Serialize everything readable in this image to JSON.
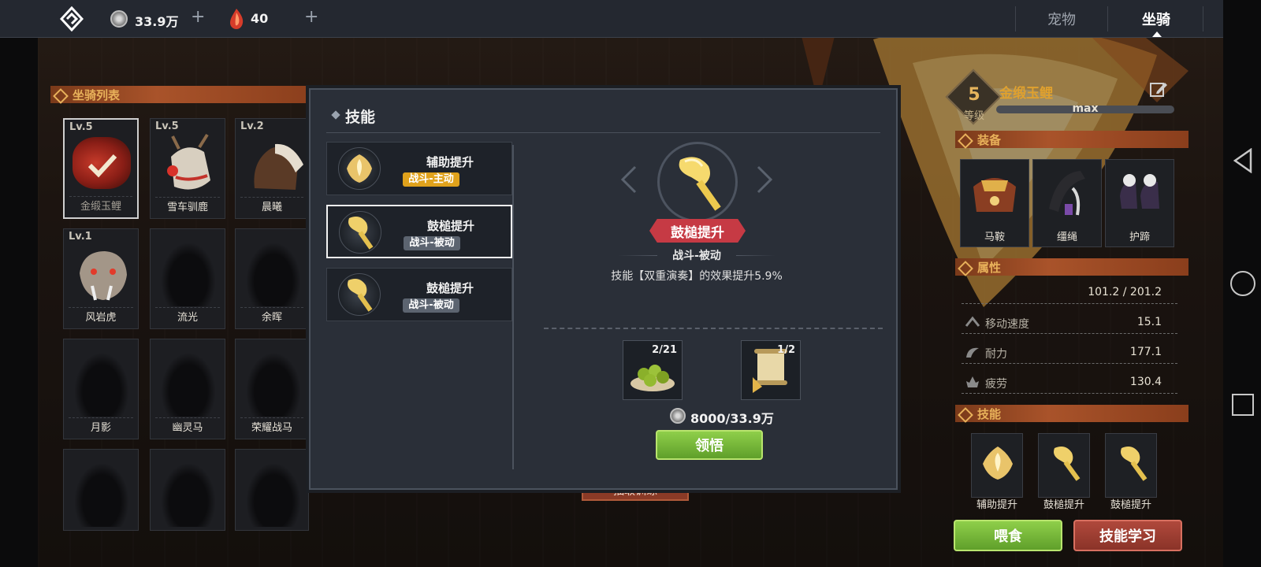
{
  "topbar": {
    "currency1": {
      "icon": "silver-coin-icon",
      "value": "33.9万"
    },
    "currency2": {
      "icon": "red-crystal-icon",
      "value": "40"
    },
    "tabs": [
      {
        "label": "宠物",
        "active": false
      },
      {
        "label": "坐骑",
        "active": true
      }
    ]
  },
  "mount_list": {
    "title": "坐骑列表",
    "items": [
      {
        "level": "Lv.5",
        "name": "金缎玉鲤",
        "owned": true,
        "selected": true
      },
      {
        "level": "Lv.5",
        "name": "雪车驯鹿",
        "owned": true
      },
      {
        "level": "Lv.2",
        "name": "晨曦",
        "owned": true
      },
      {
        "level": "Lv.1",
        "name": "风岩虎",
        "owned": true
      },
      {
        "level": "",
        "name": "流光",
        "owned": false
      },
      {
        "level": "",
        "name": "余晖",
        "owned": false
      },
      {
        "level": "",
        "name": "月影",
        "owned": false
      },
      {
        "level": "",
        "name": "幽灵马",
        "owned": false
      },
      {
        "level": "",
        "name": "荣耀战马",
        "owned": false
      },
      {
        "level": "",
        "name": "",
        "owned": false
      },
      {
        "level": "",
        "name": "",
        "owned": false
      },
      {
        "level": "",
        "name": "",
        "owned": false
      }
    ]
  },
  "mount_detail": {
    "level_number": "5",
    "level_label": "等级",
    "name": "金缎玉鲤",
    "progress_label": "max",
    "equipment_title": "装备",
    "equipment": [
      {
        "name": "马鞍"
      },
      {
        "name": "缰绳"
      },
      {
        "name": "护蹄"
      }
    ],
    "attributes_title": "属性",
    "attributes": [
      {
        "label": "",
        "value": "101.2 / 201.2"
      },
      {
        "label": "移动速度",
        "value": "15.1"
      },
      {
        "label": "耐力",
        "value": "177.1"
      },
      {
        "label": "疲劳",
        "value": "130.4"
      }
    ],
    "skills_title": "技能",
    "skills": [
      {
        "name": "辅助提升"
      },
      {
        "name": "鼓槌提升"
      },
      {
        "name": "鼓槌提升"
      }
    ],
    "feed_button": "喂食",
    "learn_button": "技能学习"
  },
  "modal": {
    "title": "技能",
    "skills": [
      {
        "name": "辅助提升",
        "tag": "战斗-主动",
        "tag_color": "#e0a21c",
        "selected": false,
        "icon": "flower-shield-icon"
      },
      {
        "name": "鼓槌提升",
        "tag": "战斗-被动",
        "tag_color": "#5c6470",
        "selected": true,
        "icon": "drumstick-icon"
      },
      {
        "name": "鼓槌提升",
        "tag": "战斗-被动",
        "tag_color": "#5c6470",
        "selected": false,
        "icon": "drumstick-icon"
      }
    ],
    "detail": {
      "name": "鼓槌提升",
      "type": "战斗-被动",
      "description": "技能【双重演奏】的效果提升5.9%",
      "materials": [
        {
          "icon": "green-fruit-plate-icon",
          "count": "2/21"
        },
        {
          "icon": "scroll-icon",
          "count": "1/2"
        }
      ],
      "cost": "8000/33.9万",
      "learn_button": "领悟"
    },
    "under_button_text": "抽取训练"
  }
}
